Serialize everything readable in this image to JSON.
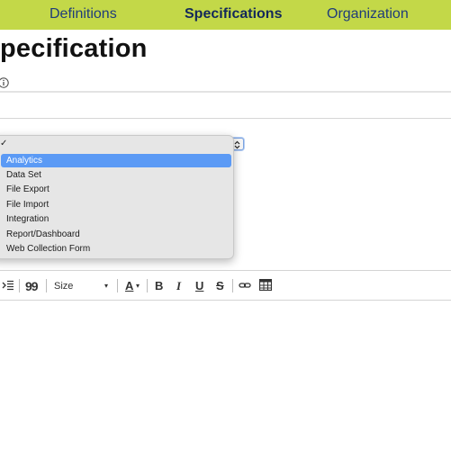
{
  "nav": {
    "tabs": [
      {
        "label": "Definitions",
        "active": false
      },
      {
        "label": "Specifications",
        "active": true
      },
      {
        "label": "Organization",
        "active": false
      }
    ],
    "bar_color": "#c3d848"
  },
  "page": {
    "title": "pecification"
  },
  "dropdown": {
    "check_mark": "✓",
    "options": [
      {
        "label": "Analytics",
        "selected": true
      },
      {
        "label": "Data Set",
        "selected": false
      },
      {
        "label": "File Export",
        "selected": false
      },
      {
        "label": "File Import",
        "selected": false
      },
      {
        "label": "Integration",
        "selected": false
      },
      {
        "label": "Report/Dashboard",
        "selected": false
      },
      {
        "label": "Web Collection Form",
        "selected": false
      }
    ],
    "highlight_color": "#5b9af5"
  },
  "toolbar": {
    "indent_icon": "indent-icon",
    "quote_label": "99",
    "size_label": "Size",
    "font_color_label": "A",
    "bold_label": "B",
    "italic_label": "I",
    "underline_label": "U",
    "strike_label": "S",
    "link_icon": "link-icon",
    "table_icon": "table-icon"
  }
}
